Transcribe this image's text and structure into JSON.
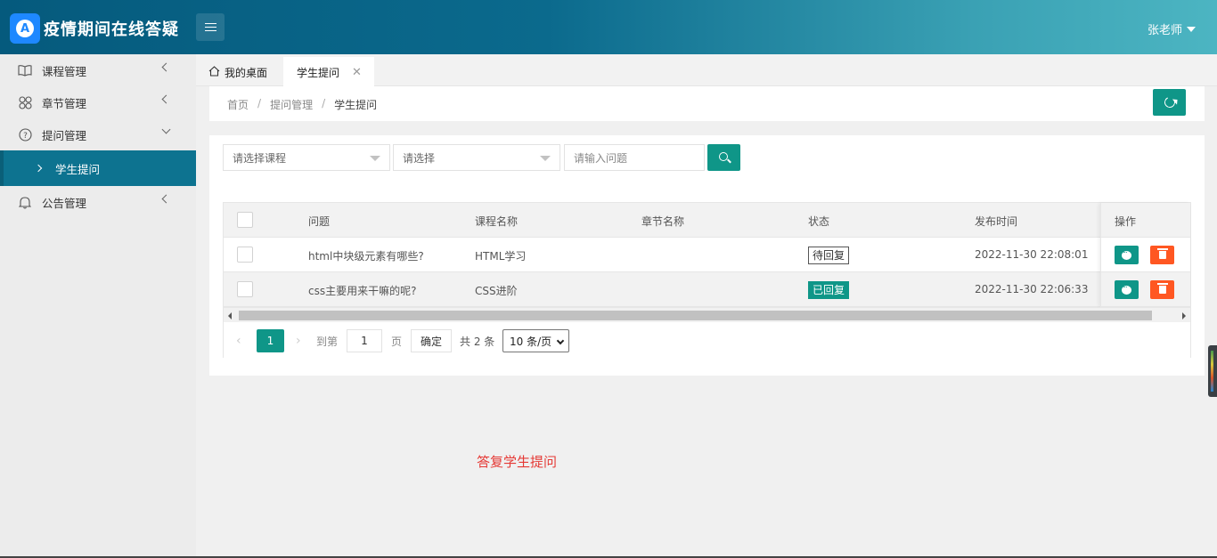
{
  "header": {
    "logo_letter": "A",
    "app_title": "疫情期间在线答疑",
    "user_name": "张老师"
  },
  "sidebar": {
    "items": [
      {
        "label": "课程管理",
        "icon": "book-icon"
      },
      {
        "label": "章节管理",
        "icon": "clover-icon"
      },
      {
        "label": "提问管理",
        "icon": "question-circle-icon"
      },
      {
        "label": "公告管理",
        "icon": "bell-icon"
      }
    ],
    "sub_active": "学生提问"
  },
  "tabs": {
    "home": "我的桌面",
    "active": "学生提问",
    "close_glyph": "✕"
  },
  "breadcrumb": {
    "items": [
      "首页",
      "提问管理",
      "学生提问"
    ],
    "separator": "/"
  },
  "filters": {
    "course_placeholder": "请选择课程",
    "select_placeholder": "请选择",
    "question_placeholder": "请输入问题"
  },
  "table": {
    "headers": [
      "问题",
      "课程名称",
      "章节名称",
      "状态",
      "发布时间",
      "操作"
    ],
    "rows": [
      {
        "question": "html中块级元素有哪些?",
        "course": "HTML学习",
        "chapter": "",
        "status": "待回复",
        "time": "2022-11-30 22:08:01"
      },
      {
        "question": "css主要用来干嘛的呢?",
        "course": "CSS进阶",
        "chapter": "",
        "status": "已回复",
        "time": "2022-11-30 22:06:33"
      }
    ]
  },
  "pager": {
    "prev": "‹",
    "current": "1",
    "next": "›",
    "goto_label": "到第",
    "goto_value": "1",
    "page_label": "页",
    "ok_label": "确定",
    "total": "共 2 条",
    "page_size": "10 条/页"
  },
  "note": "答复学生提问",
  "colors": {
    "accent": "#0f9688",
    "danger": "#ff5722",
    "note": "#e53935"
  }
}
